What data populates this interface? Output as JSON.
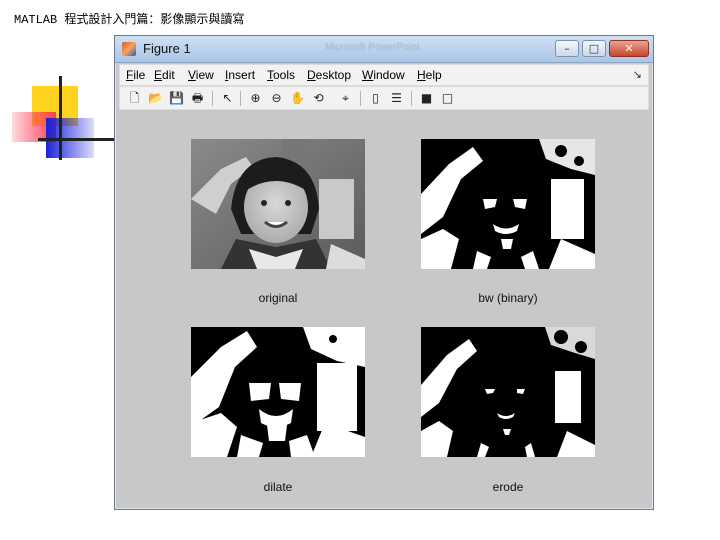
{
  "slide": {
    "header": "MATLAB 程式設計入門篇：影像顯示與讀寫"
  },
  "window": {
    "title": "Figure 1",
    "background_title": "Microsoft PowerPoint",
    "controls": {
      "minimize": "–",
      "maximize": "□",
      "close": "✕"
    }
  },
  "menubar": {
    "items": [
      {
        "label": "File"
      },
      {
        "label": "Edit"
      },
      {
        "label": "View"
      },
      {
        "label": "Insert"
      },
      {
        "label": "Tools"
      },
      {
        "label": "Desktop"
      },
      {
        "label": "Window"
      },
      {
        "label": "Help"
      }
    ],
    "overflow_arrow": "↘"
  },
  "toolbar": {
    "buttons": [
      {
        "name": "new-figure-icon",
        "glyph": "🗋"
      },
      {
        "name": "open-file-icon",
        "glyph": "📂"
      },
      {
        "name": "save-figure-icon",
        "glyph": "💾"
      },
      {
        "name": "print-figure-icon",
        "glyph": "🖶"
      },
      {
        "name": "edit-plot-arrow-icon",
        "glyph": "↖"
      },
      {
        "name": "zoom-in-icon",
        "glyph": "⊕"
      },
      {
        "name": "zoom-out-icon",
        "glyph": "⊖"
      },
      {
        "name": "pan-hand-icon",
        "glyph": "✋"
      },
      {
        "name": "rotate-3d-icon",
        "glyph": "⟲"
      },
      {
        "name": "data-cursor-icon",
        "glyph": "⌖"
      },
      {
        "name": "insert-colorbar-icon",
        "glyph": "▯"
      },
      {
        "name": "insert-legend-icon",
        "glyph": "☰"
      },
      {
        "name": "hide-plot-tools-icon",
        "glyph": "■"
      },
      {
        "name": "show-plot-tools-icon",
        "glyph": "□"
      }
    ]
  },
  "plots": [
    {
      "caption": "original",
      "kind": "grayscale"
    },
    {
      "caption": "bw (binary)",
      "kind": "binary"
    },
    {
      "caption": "dilate",
      "kind": "binary"
    },
    {
      "caption": "erode",
      "kind": "binary"
    }
  ],
  "colors": {
    "figure_background": "#c8c8c8",
    "titlebar": "#aac6e6",
    "close_button": "#c9462b"
  }
}
